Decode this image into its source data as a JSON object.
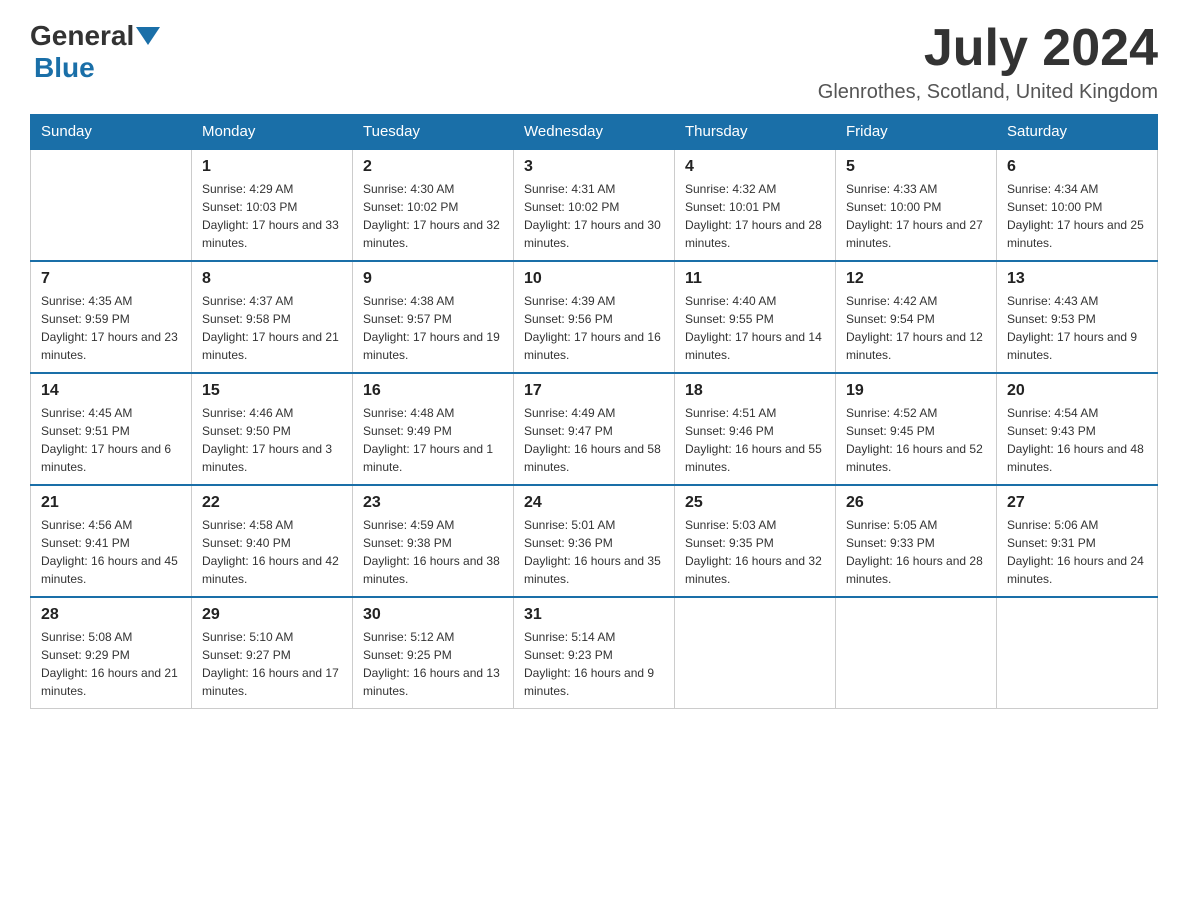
{
  "header": {
    "logo_general": "General",
    "logo_blue": "Blue",
    "month_title": "July 2024",
    "location": "Glenrothes, Scotland, United Kingdom"
  },
  "days_of_week": [
    "Sunday",
    "Monday",
    "Tuesday",
    "Wednesday",
    "Thursday",
    "Friday",
    "Saturday"
  ],
  "weeks": [
    [
      {
        "day": "",
        "sunrise": "",
        "sunset": "",
        "daylight": ""
      },
      {
        "day": "1",
        "sunrise": "Sunrise: 4:29 AM",
        "sunset": "Sunset: 10:03 PM",
        "daylight": "Daylight: 17 hours and 33 minutes."
      },
      {
        "day": "2",
        "sunrise": "Sunrise: 4:30 AM",
        "sunset": "Sunset: 10:02 PM",
        "daylight": "Daylight: 17 hours and 32 minutes."
      },
      {
        "day": "3",
        "sunrise": "Sunrise: 4:31 AM",
        "sunset": "Sunset: 10:02 PM",
        "daylight": "Daylight: 17 hours and 30 minutes."
      },
      {
        "day": "4",
        "sunrise": "Sunrise: 4:32 AM",
        "sunset": "Sunset: 10:01 PM",
        "daylight": "Daylight: 17 hours and 28 minutes."
      },
      {
        "day": "5",
        "sunrise": "Sunrise: 4:33 AM",
        "sunset": "Sunset: 10:00 PM",
        "daylight": "Daylight: 17 hours and 27 minutes."
      },
      {
        "day": "6",
        "sunrise": "Sunrise: 4:34 AM",
        "sunset": "Sunset: 10:00 PM",
        "daylight": "Daylight: 17 hours and 25 minutes."
      }
    ],
    [
      {
        "day": "7",
        "sunrise": "Sunrise: 4:35 AM",
        "sunset": "Sunset: 9:59 PM",
        "daylight": "Daylight: 17 hours and 23 minutes."
      },
      {
        "day": "8",
        "sunrise": "Sunrise: 4:37 AM",
        "sunset": "Sunset: 9:58 PM",
        "daylight": "Daylight: 17 hours and 21 minutes."
      },
      {
        "day": "9",
        "sunrise": "Sunrise: 4:38 AM",
        "sunset": "Sunset: 9:57 PM",
        "daylight": "Daylight: 17 hours and 19 minutes."
      },
      {
        "day": "10",
        "sunrise": "Sunrise: 4:39 AM",
        "sunset": "Sunset: 9:56 PM",
        "daylight": "Daylight: 17 hours and 16 minutes."
      },
      {
        "day": "11",
        "sunrise": "Sunrise: 4:40 AM",
        "sunset": "Sunset: 9:55 PM",
        "daylight": "Daylight: 17 hours and 14 minutes."
      },
      {
        "day": "12",
        "sunrise": "Sunrise: 4:42 AM",
        "sunset": "Sunset: 9:54 PM",
        "daylight": "Daylight: 17 hours and 12 minutes."
      },
      {
        "day": "13",
        "sunrise": "Sunrise: 4:43 AM",
        "sunset": "Sunset: 9:53 PM",
        "daylight": "Daylight: 17 hours and 9 minutes."
      }
    ],
    [
      {
        "day": "14",
        "sunrise": "Sunrise: 4:45 AM",
        "sunset": "Sunset: 9:51 PM",
        "daylight": "Daylight: 17 hours and 6 minutes."
      },
      {
        "day": "15",
        "sunrise": "Sunrise: 4:46 AM",
        "sunset": "Sunset: 9:50 PM",
        "daylight": "Daylight: 17 hours and 3 minutes."
      },
      {
        "day": "16",
        "sunrise": "Sunrise: 4:48 AM",
        "sunset": "Sunset: 9:49 PM",
        "daylight": "Daylight: 17 hours and 1 minute."
      },
      {
        "day": "17",
        "sunrise": "Sunrise: 4:49 AM",
        "sunset": "Sunset: 9:47 PM",
        "daylight": "Daylight: 16 hours and 58 minutes."
      },
      {
        "day": "18",
        "sunrise": "Sunrise: 4:51 AM",
        "sunset": "Sunset: 9:46 PM",
        "daylight": "Daylight: 16 hours and 55 minutes."
      },
      {
        "day": "19",
        "sunrise": "Sunrise: 4:52 AM",
        "sunset": "Sunset: 9:45 PM",
        "daylight": "Daylight: 16 hours and 52 minutes."
      },
      {
        "day": "20",
        "sunrise": "Sunrise: 4:54 AM",
        "sunset": "Sunset: 9:43 PM",
        "daylight": "Daylight: 16 hours and 48 minutes."
      }
    ],
    [
      {
        "day": "21",
        "sunrise": "Sunrise: 4:56 AM",
        "sunset": "Sunset: 9:41 PM",
        "daylight": "Daylight: 16 hours and 45 minutes."
      },
      {
        "day": "22",
        "sunrise": "Sunrise: 4:58 AM",
        "sunset": "Sunset: 9:40 PM",
        "daylight": "Daylight: 16 hours and 42 minutes."
      },
      {
        "day": "23",
        "sunrise": "Sunrise: 4:59 AM",
        "sunset": "Sunset: 9:38 PM",
        "daylight": "Daylight: 16 hours and 38 minutes."
      },
      {
        "day": "24",
        "sunrise": "Sunrise: 5:01 AM",
        "sunset": "Sunset: 9:36 PM",
        "daylight": "Daylight: 16 hours and 35 minutes."
      },
      {
        "day": "25",
        "sunrise": "Sunrise: 5:03 AM",
        "sunset": "Sunset: 9:35 PM",
        "daylight": "Daylight: 16 hours and 32 minutes."
      },
      {
        "day": "26",
        "sunrise": "Sunrise: 5:05 AM",
        "sunset": "Sunset: 9:33 PM",
        "daylight": "Daylight: 16 hours and 28 minutes."
      },
      {
        "day": "27",
        "sunrise": "Sunrise: 5:06 AM",
        "sunset": "Sunset: 9:31 PM",
        "daylight": "Daylight: 16 hours and 24 minutes."
      }
    ],
    [
      {
        "day": "28",
        "sunrise": "Sunrise: 5:08 AM",
        "sunset": "Sunset: 9:29 PM",
        "daylight": "Daylight: 16 hours and 21 minutes."
      },
      {
        "day": "29",
        "sunrise": "Sunrise: 5:10 AM",
        "sunset": "Sunset: 9:27 PM",
        "daylight": "Daylight: 16 hours and 17 minutes."
      },
      {
        "day": "30",
        "sunrise": "Sunrise: 5:12 AM",
        "sunset": "Sunset: 9:25 PM",
        "daylight": "Daylight: 16 hours and 13 minutes."
      },
      {
        "day": "31",
        "sunrise": "Sunrise: 5:14 AM",
        "sunset": "Sunset: 9:23 PM",
        "daylight": "Daylight: 16 hours and 9 minutes."
      },
      {
        "day": "",
        "sunrise": "",
        "sunset": "",
        "daylight": ""
      },
      {
        "day": "",
        "sunrise": "",
        "sunset": "",
        "daylight": ""
      },
      {
        "day": "",
        "sunrise": "",
        "sunset": "",
        "daylight": ""
      }
    ]
  ]
}
